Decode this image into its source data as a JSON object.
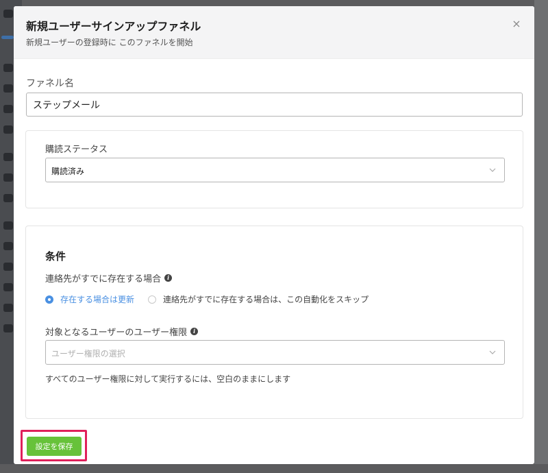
{
  "modal": {
    "title": "新規ユーザーサインアップファネル",
    "subtitle": "新規ユーザーの登録時に このファネルを開始",
    "close_icon": "×"
  },
  "funnel_name": {
    "label": "ファネル名",
    "value": "ステップメール"
  },
  "subscription": {
    "label": "購読ステータス",
    "selected": "購読済み"
  },
  "conditions": {
    "title": "条件",
    "exists_label": "連絡先がすでに存在する場合",
    "options": [
      {
        "label": "存在する場合は更新",
        "selected": true
      },
      {
        "label": "連絡先がすでに存在する場合は、この自動化をスキップ",
        "selected": false
      }
    ],
    "roles_label": "対象となるユーザーのユーザー権限",
    "roles_placeholder": "ユーザー権限の選択",
    "roles_hint": "すべてのユーザー権限に対して実行するには、空白のままにします"
  },
  "footer": {
    "save_label": "設定を保存"
  },
  "colors": {
    "accent": "#4a90e2",
    "save": "#67c23a",
    "highlight": "#e0205a"
  }
}
